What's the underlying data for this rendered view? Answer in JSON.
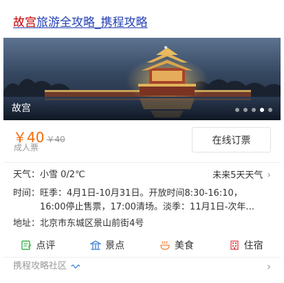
{
  "title": {
    "highlight": "故宫",
    "rest": "旅游全攻略_携程攻略"
  },
  "banner": {
    "caption": "故宫",
    "slide_count": 5,
    "active_slide": 4
  },
  "ticket": {
    "price": "￥40",
    "original_price": "￥40",
    "note": "成人票",
    "book_label": "在线订票"
  },
  "weather": {
    "label": "天气：",
    "value": "小雪  0/2℃",
    "forecast_link": "未来5天天气"
  },
  "hours": {
    "line1": "时间：旺季：4月1日-10月31日。开放时间8:30-16:10，",
    "line2": "16:00停止售票，17:00清场。淡季：11月1日-次年..."
  },
  "address": {
    "label": "地址：",
    "value": "北京市东城区景山前街4号"
  },
  "nav": [
    {
      "label": "点评",
      "icon": "review-icon",
      "color": "#3db04a"
    },
    {
      "label": "景点",
      "icon": "attraction-icon",
      "color": "#3b7fd6"
    },
    {
      "label": "美食",
      "icon": "food-icon",
      "color": "#f0843c"
    },
    {
      "label": "住宿",
      "icon": "hotel-icon",
      "color": "#e0474c"
    }
  ],
  "community": {
    "label": "携程攻略社区"
  },
  "colors": {
    "link": "#2440b3",
    "highlight": "#c00000",
    "price": "#f26a09"
  }
}
